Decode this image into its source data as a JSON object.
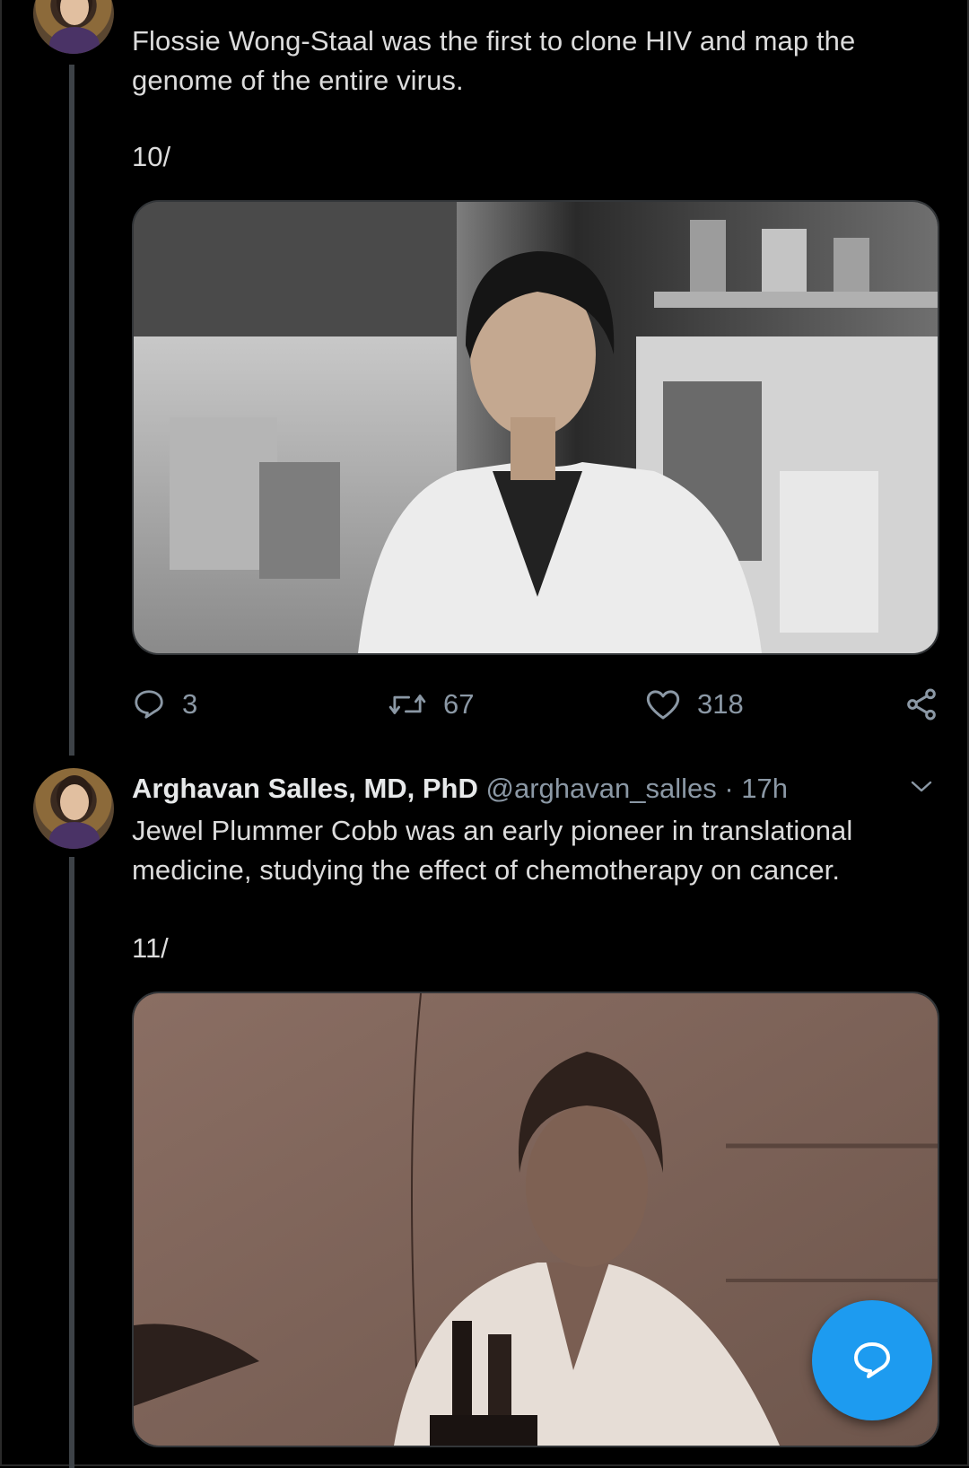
{
  "thread": [
    {
      "text": "Flossie Wong-Staal was the first to clone HIV and map the genome of the entire virus.",
      "thread_number": "10/",
      "media_description": "Black and white photo of scientist in lab coat in laboratory",
      "actions": {
        "reply_count": "3",
        "retweet_count": "67",
        "like_count": "318"
      }
    },
    {
      "author": {
        "name": "Arghavan Salles, MD, PhD",
        "handle": "@arghavan_salles",
        "time": " · 17h"
      },
      "text": "Jewel Plummer Cobb was an early pioneer in translational medicine, studying the effect of chemotherapy on cancer.",
      "thread_number": "11/",
      "media_description": "Sepia photo of scientist at microscope"
    }
  ],
  "icons": {
    "reply": "reply-icon",
    "retweet": "retweet-icon",
    "like": "heart-icon",
    "share": "share-icon",
    "menu": "chevron-down-icon",
    "compose": "compose-reply-icon"
  },
  "colors": {
    "background": "#000000",
    "text": "#dcdcdc",
    "secondary": "#8b98a5",
    "accent": "#1d9bf0"
  }
}
